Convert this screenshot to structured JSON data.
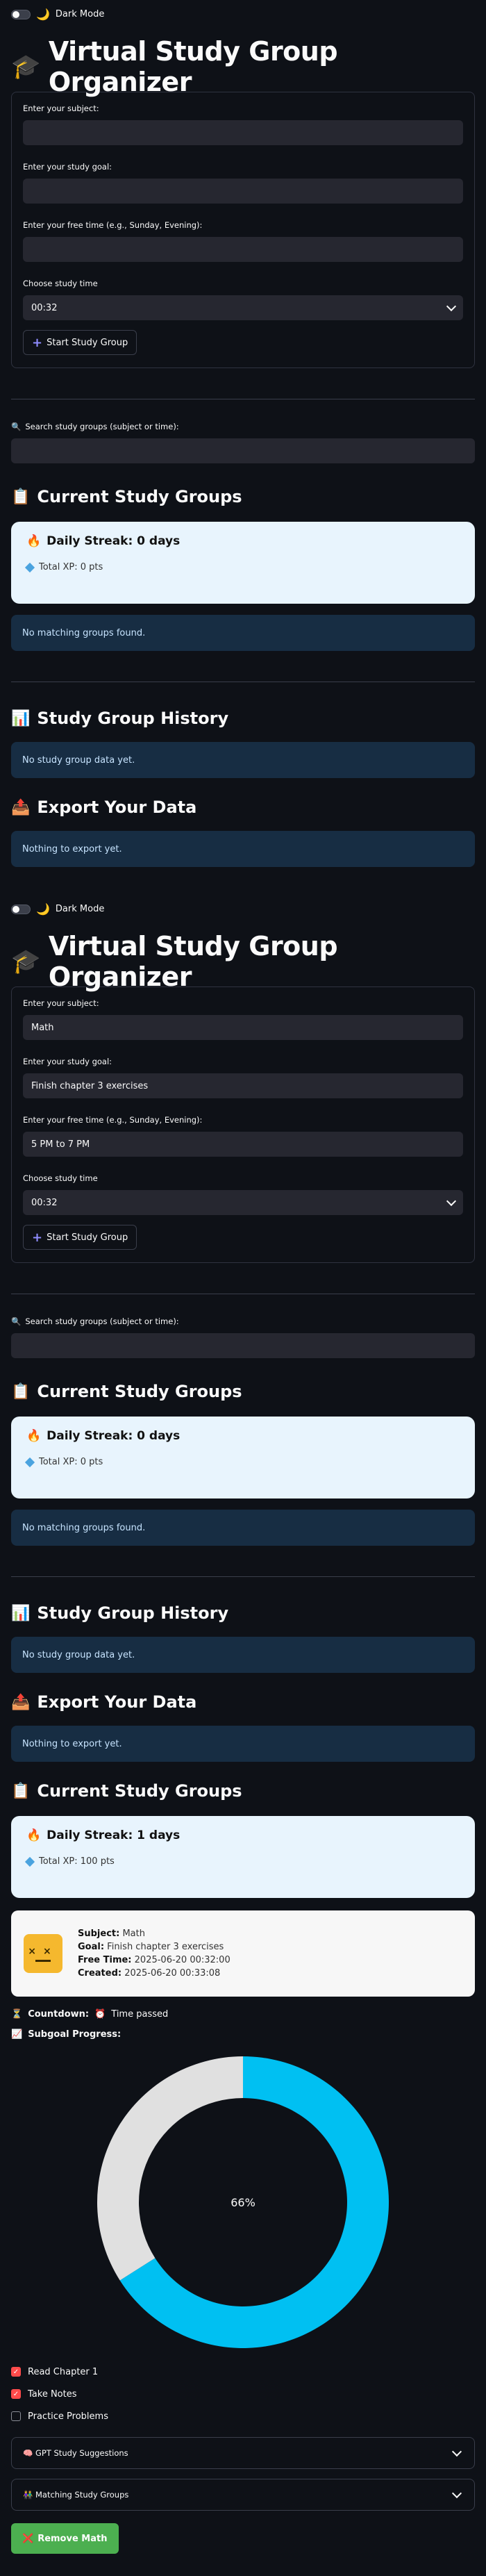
{
  "dark_mode": {
    "label": "Dark Mode",
    "enabled": false
  },
  "app_title": "Virtual Study Group Organizer",
  "form_labels": {
    "subject": "Enter your subject:",
    "goal": "Enter your study goal:",
    "free_time": "Enter your free time (e.g., Sunday, Evening):",
    "study_time": "Choose study time"
  },
  "start_button": "Start Study Group",
  "search_label": "Search study groups (subject or time):",
  "headings": {
    "current": "Current Study Groups",
    "history": "Study Group History",
    "export": "Export Your Data"
  },
  "blocks": [
    {
      "form": {
        "subject": "",
        "goal": "",
        "free_time": "",
        "study_time": "00:32"
      },
      "streak": {
        "label": "Daily Streak: 0 days",
        "xp": "Total XP: 0 pts"
      },
      "no_match": "No matching groups found.",
      "history_msg": "No study group data yet.",
      "export_msg": "Nothing to export yet."
    },
    {
      "form": {
        "subject": "Math",
        "goal": "Finish chapter 3 exercises",
        "free_time": "5 PM to 7 PM",
        "study_time": "00:32"
      },
      "streak": {
        "label": "Daily Streak: 0 days",
        "xp": "Total XP: 0 pts"
      },
      "no_match": "No matching groups found.",
      "history_msg": "No study group data yet.",
      "export_msg": "Nothing to export yet."
    }
  ],
  "final_section": {
    "streak": {
      "label": "Daily Streak: 1 days",
      "xp": "Total XP: 100 pts"
    },
    "group": {
      "subject_label": "Subject:",
      "subject": "Math",
      "goal_label": "Goal:",
      "goal": "Finish chapter 3 exercises",
      "free_time_label": "Free Time:",
      "free_time": "2025-06-20 00:32:00",
      "created_label": "Created:",
      "created": "2025-06-20 00:33:08"
    },
    "countdown_label": "Countdown:",
    "countdown_value": "Time passed",
    "subgoal_label": "Subgoal Progress:",
    "donut": {
      "percent_label": "66%",
      "value": 0.66,
      "done_color": "#00c0f2",
      "remaining_color": "#e0e0e0"
    },
    "subgoals": [
      {
        "label": "Read Chapter 1",
        "checked": true
      },
      {
        "label": "Take Notes",
        "checked": true
      },
      {
        "label": "Practice Problems",
        "checked": false
      }
    ],
    "gpt_expander": "GPT Study Suggestions",
    "matching_expander": "Matching Study Groups",
    "remove_button": "Remove Math"
  },
  "colors": {
    "bg": "#0e1117",
    "input": "#262730",
    "info_bg": "#172d43",
    "accent_green": "#4caf50",
    "checkbox_red": "#ff4b4b"
  }
}
